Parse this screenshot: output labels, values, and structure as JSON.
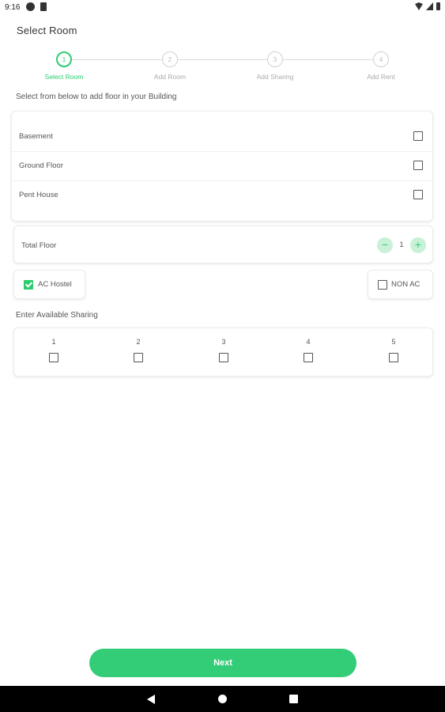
{
  "status_bar": {
    "time": "9:16",
    "icons": [
      "sync-icon",
      "sim-icon",
      "wifi-icon",
      "signal-icon",
      "battery-icon"
    ]
  },
  "page_title": "Select Room",
  "stepper": {
    "steps": [
      {
        "number": "1",
        "label": "Select Room",
        "active": true
      },
      {
        "number": "2",
        "label": "Add Room",
        "active": false
      },
      {
        "number": "3",
        "label": "Add Sharing",
        "active": false
      },
      {
        "number": "4",
        "label": "Add Rent",
        "active": false
      }
    ]
  },
  "instruction": "Select from below to add floor in your Building",
  "floors": [
    {
      "label": "Basement",
      "checked": false
    },
    {
      "label": "Ground Floor",
      "checked": false
    },
    {
      "label": "Pent House",
      "checked": false
    }
  ],
  "total_floor": {
    "label": "Total Floor",
    "value": "1",
    "minus_icon": "minus-icon",
    "plus_icon": "plus-icon"
  },
  "hostel_type": {
    "ac": {
      "label": "AC Hostel",
      "checked": true
    },
    "non_ac": {
      "label": "NON AC",
      "checked": false
    }
  },
  "sharing": {
    "title": "Enter Available Sharing",
    "options": [
      "1",
      "2",
      "3",
      "4",
      "5"
    ]
  },
  "next_button": "Next",
  "colors": {
    "accent": "#2ecc71",
    "accent_light": "#c9f1d8",
    "button": "#33cc77"
  }
}
